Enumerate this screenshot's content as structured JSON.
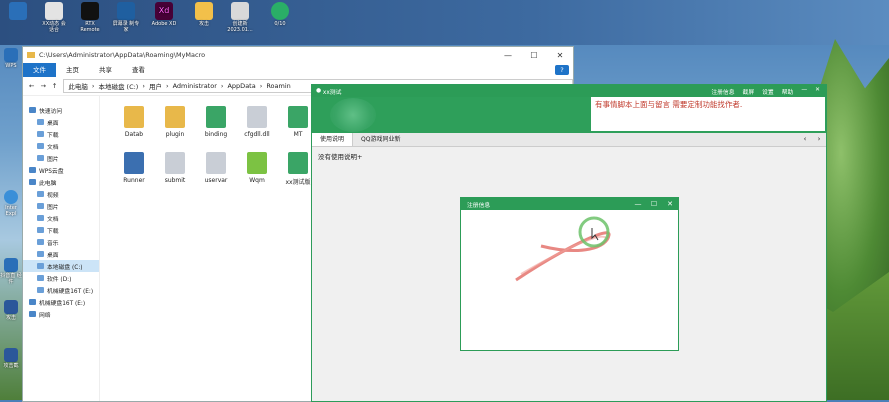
{
  "desktop": {
    "left_icons": [
      "WPS",
      "Inter Expl",
      "抖音直 经件",
      "攻击",
      "攻击截"
    ],
    "top_icons": [
      "",
      "XX动态 会话合",
      "RTX Remote",
      "屏幕录 制专家",
      "Adobe XD",
      "攻击",
      "创建新 2023.01...",
      "0/10"
    ]
  },
  "explorer": {
    "path": "C:\\Users\\Administrator\\AppData\\Roaming\\MyMacro",
    "ribbon_tabs": [
      "文件",
      "主页",
      "共享",
      "查看"
    ],
    "help": "?",
    "address": [
      "此电脑",
      "本地磁盘 (C:)",
      "用户",
      "Administrator",
      "AppData",
      "Roamin"
    ],
    "nav": [
      {
        "label": "快速访问",
        "level": 0
      },
      {
        "label": "桌面",
        "level": 1
      },
      {
        "label": "下载",
        "level": 1
      },
      {
        "label": "文档",
        "level": 1
      },
      {
        "label": "图片",
        "level": 1
      },
      {
        "label": "WPS云盘",
        "level": 0
      },
      {
        "label": "此电脑",
        "level": 0
      },
      {
        "label": "视频",
        "level": 1
      },
      {
        "label": "图片",
        "level": 1
      },
      {
        "label": "文档",
        "level": 1
      },
      {
        "label": "下载",
        "level": 1
      },
      {
        "label": "音乐",
        "level": 1
      },
      {
        "label": "桌面",
        "level": 1
      },
      {
        "label": "本地磁盘 (C:)",
        "level": 1,
        "selected": true
      },
      {
        "label": "软件 (D:)",
        "level": 1
      },
      {
        "label": "机械硬盘16T (E:)",
        "level": 1
      },
      {
        "label": "机械硬盘16T (E:)",
        "level": 0
      },
      {
        "label": "网络",
        "level": 0
      }
    ],
    "files": [
      {
        "name": "Datab",
        "color": "#e8b84a"
      },
      {
        "name": "plugin",
        "color": "#e8b84a"
      },
      {
        "name": "binding",
        "color": "#3aa566"
      },
      {
        "name": "cfgdll.dll",
        "color": "#c9ced6"
      },
      {
        "name": "MT",
        "color": "#3aa566"
      },
      {
        "name": "Runner",
        "color": "#3b6fb0"
      },
      {
        "name": "submit",
        "color": "#c9ced6"
      },
      {
        "name": "uservar",
        "color": "#c9ced6"
      },
      {
        "name": "Wqm",
        "color": "#7cc243"
      },
      {
        "name": "xx测试版",
        "color": "#3aa566"
      }
    ]
  },
  "app": {
    "title": "xx测试",
    "actions": [
      "注册信息",
      "截屏",
      "设置",
      "帮助"
    ],
    "notice": "有事情脚本上面与留言 需要定制功能找作者.",
    "tabs": [
      "使用说明",
      "QQ游戏同业新"
    ],
    "content_text": "没有使用说明+"
  },
  "dialog": {
    "title": "注册信息"
  }
}
